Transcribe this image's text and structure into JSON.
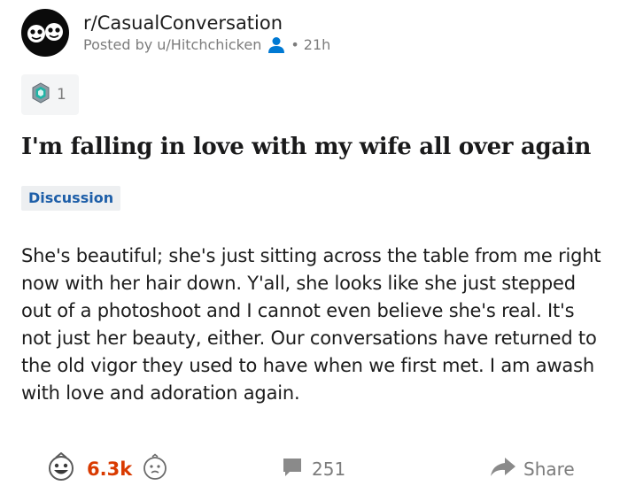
{
  "post": {
    "subreddit": "r/CasualConversation",
    "posted_by": "Posted by u/Hitchchicken",
    "age": "21h",
    "award_count": "1",
    "title": "I'm falling in love with my wife all over again",
    "flair": "Discussion",
    "body": "She's beautiful; she's just sitting across the table from me right now with her hair down. Y'all, she looks like she just stepped out of a photoshoot and I cannot even believe she's real. It's not just her beauty, either. Our conversations have returned to the old vigor they used to have when we first met. I am awash with love and adoration again."
  },
  "actions": {
    "score": "6.3k",
    "comments": "251",
    "share": "Share"
  },
  "colors": {
    "score": "#d93a00",
    "flair_text": "#1d5ea8",
    "meta_text": "#7c7c7c",
    "person_icon": "#0079d3",
    "avatar_bg": "#0b0b0b"
  },
  "icons": {
    "subreddit": "subreddit-avatar-icon",
    "user": "person-icon",
    "award": "award-icon",
    "upvote": "upvote-icon",
    "downvote": "downvote-icon",
    "comment": "comment-icon",
    "share": "share-arrow-icon"
  }
}
